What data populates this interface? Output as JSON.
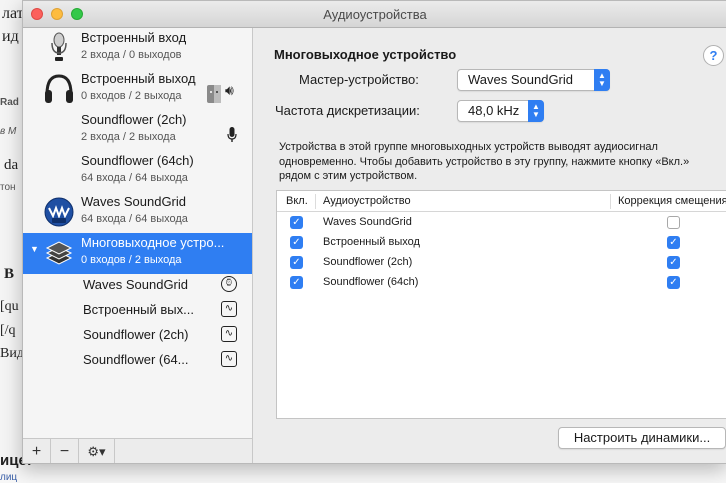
{
  "window": {
    "title": "Аудиоустройства"
  },
  "background": {
    "frag_1": "лат",
    "frag_2": "ид",
    "frag_3": "Rad",
    "frag_4": "в М",
    "frag_5": "da",
    "frag_6": "тон",
    "frag_7": "В",
    "frag_8": "[qu",
    "frag_9": "[/q",
    "frag_10": "Вид",
    "frag_11": "ице:",
    "frag_12": "лиц"
  },
  "sidebar": {
    "devices": [
      {
        "name": "Встроенный вход",
        "sub": "2 входа / 0 выходов",
        "icon": "microphone-icon"
      },
      {
        "name": "Встроенный выход",
        "sub": "0 входов / 2 выхода",
        "icon": "headphones-icon"
      },
      {
        "name": "Soundflower (2ch)",
        "sub": "2 входа / 2 выхода"
      },
      {
        "name": "Soundflower (64ch)",
        "sub": "64 входа / 64 выхода"
      },
      {
        "name": "Waves SoundGrid",
        "sub": "64 входа / 64 выхода",
        "icon": "waves-icon"
      },
      {
        "name": "Многовыходное устро...",
        "sub": "0 входов / 2 выхода",
        "icon": "multi-output-icon"
      }
    ],
    "sub_devices": [
      {
        "name": "Waves SoundGrid",
        "icon": "clock-icon"
      },
      {
        "name": "Встроенный вых...",
        "icon": "waveform-icon"
      },
      {
        "name": "Soundflower (2ch)",
        "icon": "waveform-icon"
      },
      {
        "name": "Soundflower (64...",
        "icon": "waveform-icon"
      }
    ],
    "footer": {
      "add": "+",
      "remove": "−",
      "gear": "⚙▾"
    }
  },
  "main": {
    "title": "Многовыходное устройство",
    "help": "?",
    "master_label": "Мастер-устройство:",
    "master_value": "Waves SoundGrid",
    "rate_label": "Частота дискретизации:",
    "rate_value": "48,0 kHz",
    "description": "Устройства в этой группе многовыходных устройств выводят аудиосигнал одновременно. Чтобы добавить устройство в эту группу, нажмите кнопку «Вкл.» рядом с этим устройством.",
    "table": {
      "headers": {
        "on": "Вкл.",
        "device": "Аудиоустройство",
        "drift": "Коррекция смещения"
      },
      "rows": [
        {
          "device": "Waves SoundGrid",
          "on": true,
          "drift": false
        },
        {
          "device": "Встроенный выход",
          "on": true,
          "drift": true
        },
        {
          "device": "Soundflower (2ch)",
          "on": true,
          "drift": true
        },
        {
          "device": "Soundflower (64ch)",
          "on": true,
          "drift": true
        }
      ]
    },
    "configure_speakers": "Настроить динамики..."
  },
  "colors": {
    "accent": "#2f7ef2",
    "selection": "#2f7ef2"
  }
}
